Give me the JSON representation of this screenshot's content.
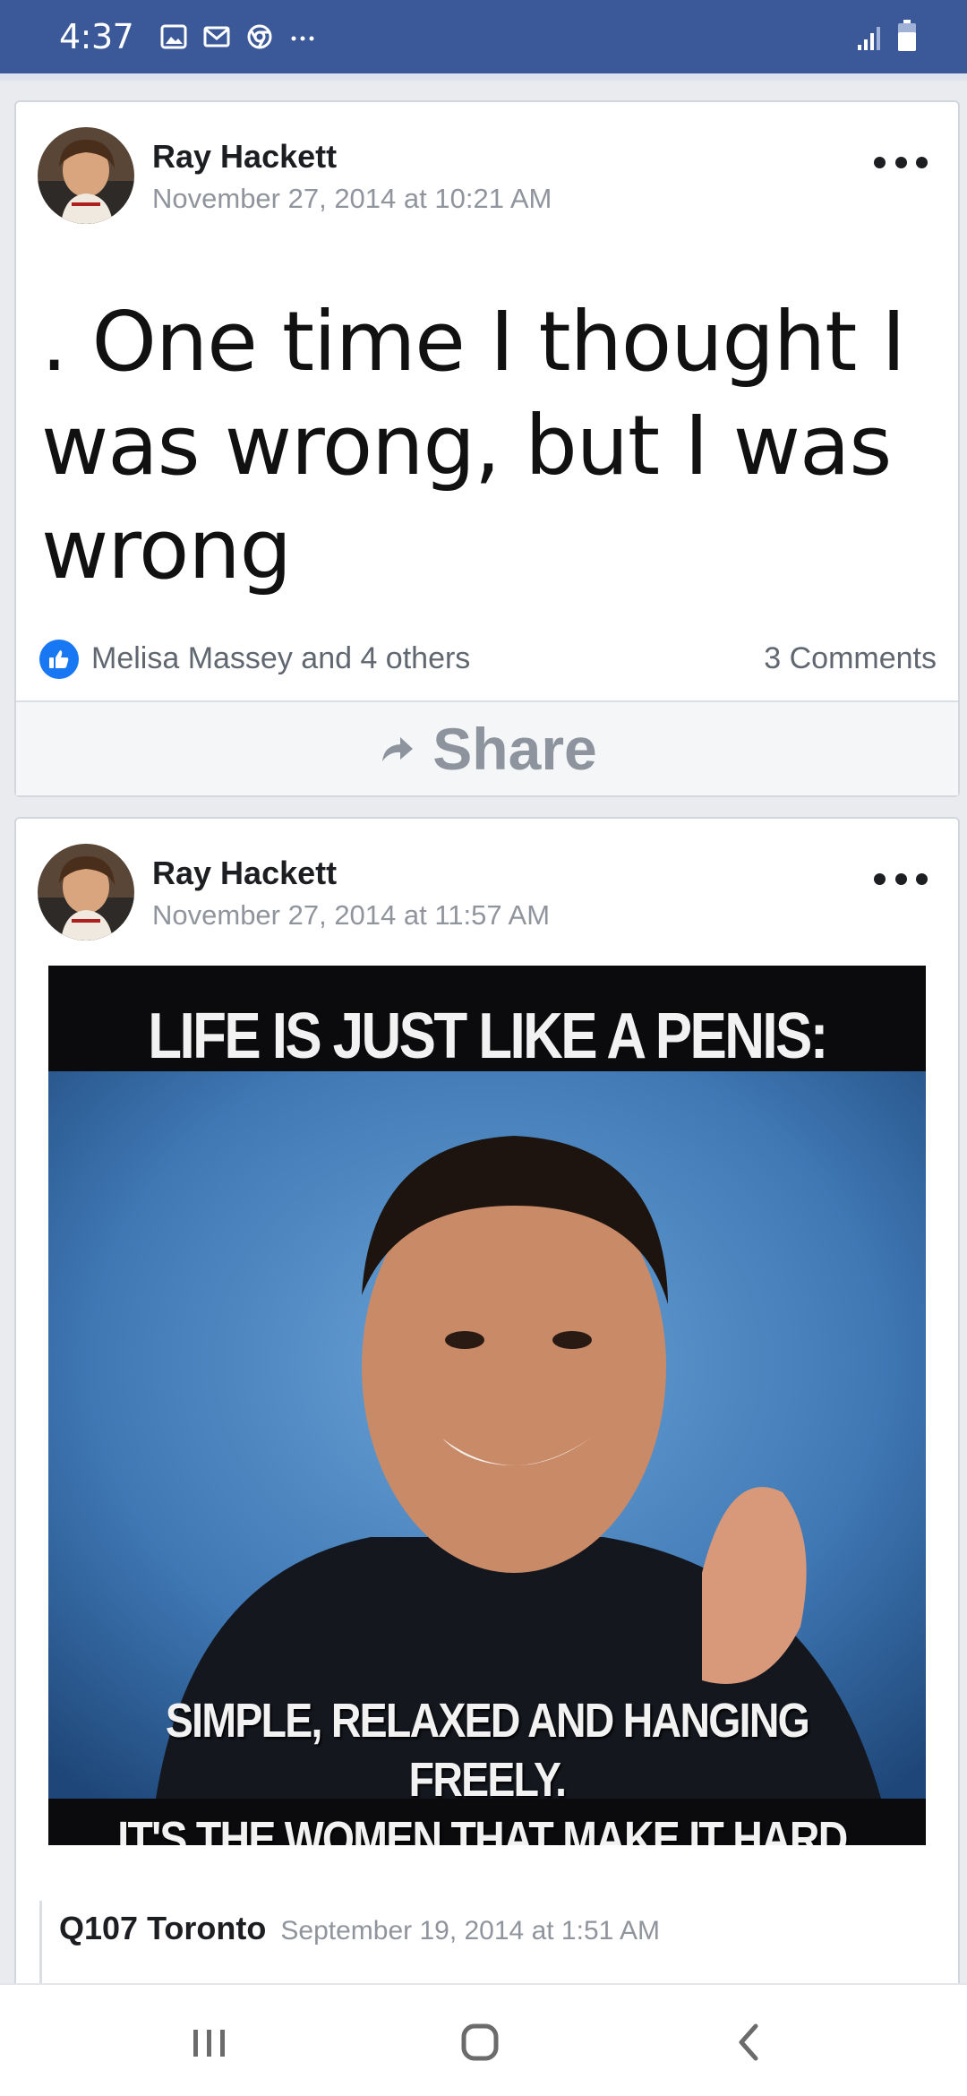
{
  "status_bar": {
    "time": "4:37",
    "icons": [
      "gallery-icon",
      "gmail-icon",
      "chrome-icon",
      "more-dots-icon"
    ],
    "right_icons": [
      "signal-icon",
      "battery-icon"
    ],
    "color": "#3b5998"
  },
  "posts": [
    {
      "author": "Ray Hackett",
      "timestamp": "November 27, 2014 at 10:21 AM",
      "text": ". One time I thought I was wrong, but I was wrong",
      "reactions": "Melisa Massey and 4 others",
      "comments": "3 Comments",
      "share_label": "Share"
    },
    {
      "author": "Ray Hackett",
      "timestamp": "November 27, 2014 at 11:57 AM",
      "image": {
        "top_text": "LIFE IS JUST LIKE A PENIS:",
        "bottom_line1": "SIMPLE, RELAXED AND HANGING FREELY.",
        "bottom_line2": "IT'S THE WOMEN THAT MAKE IT HARD."
      },
      "shared_from": {
        "source": "Q107 Toronto",
        "timestamp": "September 19, 2014 at 1:51 AM"
      }
    }
  ],
  "nav": {
    "buttons": [
      "recent-apps-icon",
      "home-icon",
      "back-icon"
    ]
  },
  "colors": {
    "facebook_blue": "#3b5998",
    "like_blue": "#1877f2",
    "meta_gray": "#90949c"
  }
}
